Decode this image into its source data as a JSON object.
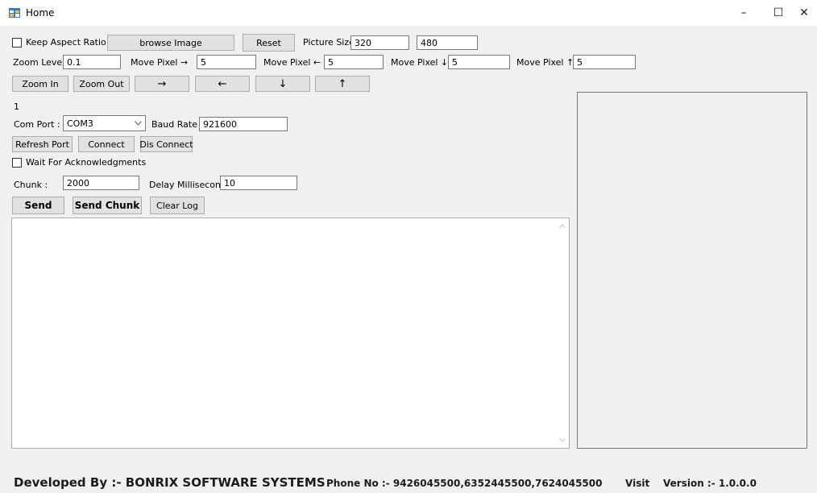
{
  "window": {
    "title": "Home",
    "minimize_glyph": "–",
    "maximize_glyph": "☐",
    "close_glyph": "✕"
  },
  "image": {
    "keep_aspect_label": "Keep Aspect Ratio",
    "keep_aspect_checked": false,
    "browse_label": "browse Image",
    "reset_label": "Reset",
    "picture_size_label": "Picture Size",
    "picture_width": "320",
    "picture_height": "480"
  },
  "move": {
    "zoom_level_label": "Zoom Level",
    "zoom_level_value": "0.1",
    "right_label": "Move Pixel →",
    "right_value": "5",
    "left_label": "Move Pixel ←",
    "left_value": "5",
    "down_label": "Move Pixel ↓",
    "down_value": "5",
    "up_label": "Move Pixel ↑",
    "up_value": "5"
  },
  "toolbar": {
    "zoom_in": "Zoom In",
    "zoom_out": "Zoom Out",
    "arrow_right": "→",
    "arrow_left": "←",
    "arrow_down": "↓",
    "arrow_up": "↑"
  },
  "counter": "1",
  "port": {
    "com_port_label": "Com Port :",
    "com_port_value": "COM3",
    "baud_rate_label": "Baud Rate :",
    "baud_rate_value": "921600",
    "refresh_label": "Refresh Port",
    "connect_label": "Connect",
    "disconnect_label": "Dis Connect"
  },
  "transfer": {
    "wait_ack_label": "Wait For Acknowledgments",
    "wait_ack_checked": false,
    "chunk_label": "Chunk :",
    "chunk_value": "2000",
    "delay_label": "Delay Millisecond :",
    "delay_value": "10",
    "send_label": "Send",
    "send_chunk_label": "Send Chunk",
    "clear_log_label": "Clear Log"
  },
  "footer": {
    "developer": "Developed By :- BONRIX SOFTWARE SYSTEMS",
    "phone": "Phone No :- 9426045500,6352445500,7624045500",
    "visit": "Visit",
    "version": "Version :- 1.0.0.0"
  },
  "colors": {
    "window_bg": "#f0f0f0",
    "button_bg": "#e1e1e1",
    "button_border": "#adadad",
    "input_border": "#7a7a7a"
  }
}
